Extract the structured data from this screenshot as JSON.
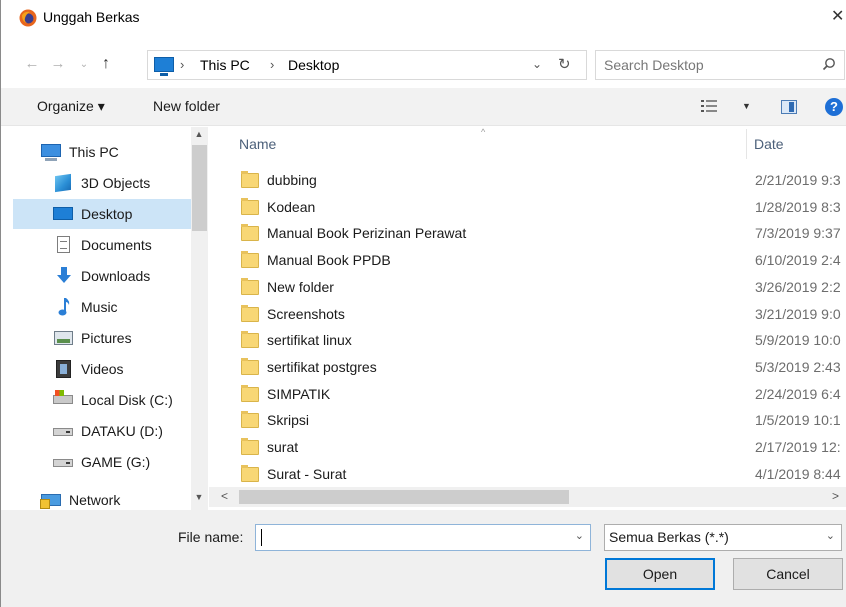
{
  "window": {
    "title": "Unggah Berkas",
    "close_glyph": "✕"
  },
  "nav": {
    "back_glyph": "←",
    "forward_glyph": "→",
    "recent_glyph": "⌄",
    "up_glyph": "↑",
    "breadcrumb": [
      "This PC",
      "Desktop"
    ],
    "separator": "›",
    "dropdown_glyph": "⌄",
    "refresh_glyph": "↻",
    "search_placeholder": "Search Desktop"
  },
  "toolbar": {
    "organize_label": "Organize ▾",
    "new_folder_label": "New folder",
    "view_dropdown_glyph": "▼",
    "help_glyph": "?"
  },
  "sidebar": {
    "items": [
      {
        "label": "This PC",
        "icon": "pc-icon"
      },
      {
        "label": "3D Objects",
        "icon": "cube-icon"
      },
      {
        "label": "Desktop",
        "icon": "desktop-icon",
        "selected": true
      },
      {
        "label": "Documents",
        "icon": "document-icon"
      },
      {
        "label": "Downloads",
        "icon": "download-icon"
      },
      {
        "label": "Music",
        "icon": "music-icon"
      },
      {
        "label": "Pictures",
        "icon": "picture-icon"
      },
      {
        "label": "Videos",
        "icon": "video-icon"
      },
      {
        "label": "Local Disk (C:)",
        "icon": "local-disk-icon"
      },
      {
        "label": "DATAKU (D:)",
        "icon": "drive-icon"
      },
      {
        "label": "GAME (G:)",
        "icon": "drive-icon"
      },
      {
        "label": "Network",
        "icon": "network-icon"
      }
    ],
    "scroll_up_glyph": "▲",
    "scroll_down_glyph": "▼"
  },
  "filelist": {
    "columns": {
      "name": "Name",
      "date": "Date",
      "sort_glyph": "^"
    },
    "rows": [
      {
        "name": "dubbing",
        "date": "2/21/2019 9:3"
      },
      {
        "name": "Kodean",
        "date": "1/28/2019 8:3"
      },
      {
        "name": "Manual Book Perizinan Perawat",
        "date": "7/3/2019 9:37"
      },
      {
        "name": "Manual Book PPDB",
        "date": "6/10/2019 2:4"
      },
      {
        "name": "New folder",
        "date": "3/26/2019 2:2"
      },
      {
        "name": "Screenshots",
        "date": "3/21/2019 9:0"
      },
      {
        "name": "sertifikat linux",
        "date": "5/9/2019 10:0"
      },
      {
        "name": "sertifikat postgres",
        "date": "5/3/2019 2:43"
      },
      {
        "name": "SIMPATIK",
        "date": "2/24/2019 6:4"
      },
      {
        "name": "Skripsi",
        "date": "1/5/2019 10:1"
      },
      {
        "name": "surat",
        "date": "2/17/2019 12:"
      },
      {
        "name": "Surat - Surat",
        "date": "4/1/2019 8:44"
      }
    ],
    "hscroll_left_glyph": "<",
    "hscroll_right_glyph": ">"
  },
  "bottom": {
    "file_name_label": "File name:",
    "file_name_value": "",
    "file_name_dropdown_glyph": "⌄",
    "file_type_label": "Semua Berkas (*.*)",
    "file_type_dropdown_glyph": "⌄",
    "open_label": "Open",
    "cancel_label": "Cancel"
  },
  "colors": {
    "selection": "#cce4f7",
    "accent": "#0078d7",
    "folder": "#f8d775"
  }
}
